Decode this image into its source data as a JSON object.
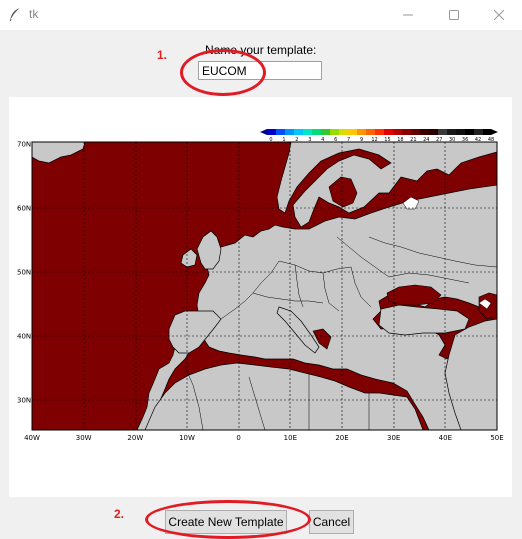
{
  "window": {
    "title": "tk",
    "app_icon": "feather-icon"
  },
  "form": {
    "label": "Name your template:",
    "template_name": "EUCOM"
  },
  "annotations": {
    "step1": "1.",
    "step2": "2."
  },
  "buttons": {
    "create": "Create New Template",
    "cancel": "Cancel"
  },
  "map": {
    "lat_labels": [
      "70N",
      "60N",
      "50N",
      "40N",
      "30N"
    ],
    "lon_labels": [
      "40W",
      "30W",
      "20W",
      "10W",
      "0",
      "10E",
      "20E",
      "30E",
      "40E",
      "50E"
    ],
    "colorbar_labels": [
      "0",
      "1",
      "2",
      "3",
      "4",
      "6",
      "7",
      "9",
      "12",
      "15",
      "18",
      "21",
      "24",
      "27",
      "30",
      "36",
      "42",
      "48"
    ],
    "colors": {
      "water": "#7f0000",
      "land": "#c8c8c8",
      "coast": "#000000"
    }
  },
  "colors": {
    "annotation": "#e01b24"
  }
}
